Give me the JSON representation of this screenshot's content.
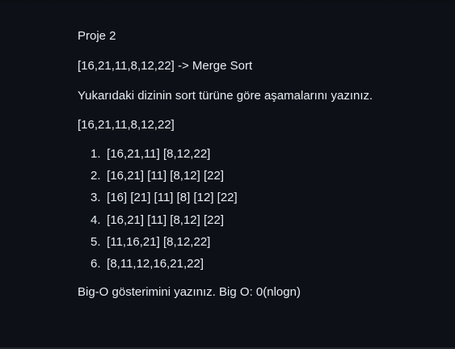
{
  "colors": {
    "background": "#0d1117",
    "text": "#e6edf3",
    "divider": "#21262d"
  },
  "doc": {
    "title": "Proje 2",
    "problem_line": "[16,21,11,8,12,22] -> Merge Sort",
    "instruction": "Yukarıdaki dizinin sort türüne göre aşamalarını yazınız.",
    "array_line": "[16,21,11,8,12,22]",
    "steps": [
      {
        "num": "1.",
        "text": "[16,21,11] [8,12,22]"
      },
      {
        "num": "2.",
        "text": "[16,21] [11] [8,12] [22]"
      },
      {
        "num": "3.",
        "text": "[16] [21] [11] [8] [12] [22]"
      },
      {
        "num": "4.",
        "text": "[16,21] [11] [8,12] [22]"
      },
      {
        "num": "5.",
        "text": "[11,16,21] [8,12,22]"
      },
      {
        "num": "6.",
        "text": "[8,11,12,16,21,22]"
      }
    ],
    "bigo_line": "Big-O gösterimini yazınız. Big O: 0(nlogn)"
  }
}
